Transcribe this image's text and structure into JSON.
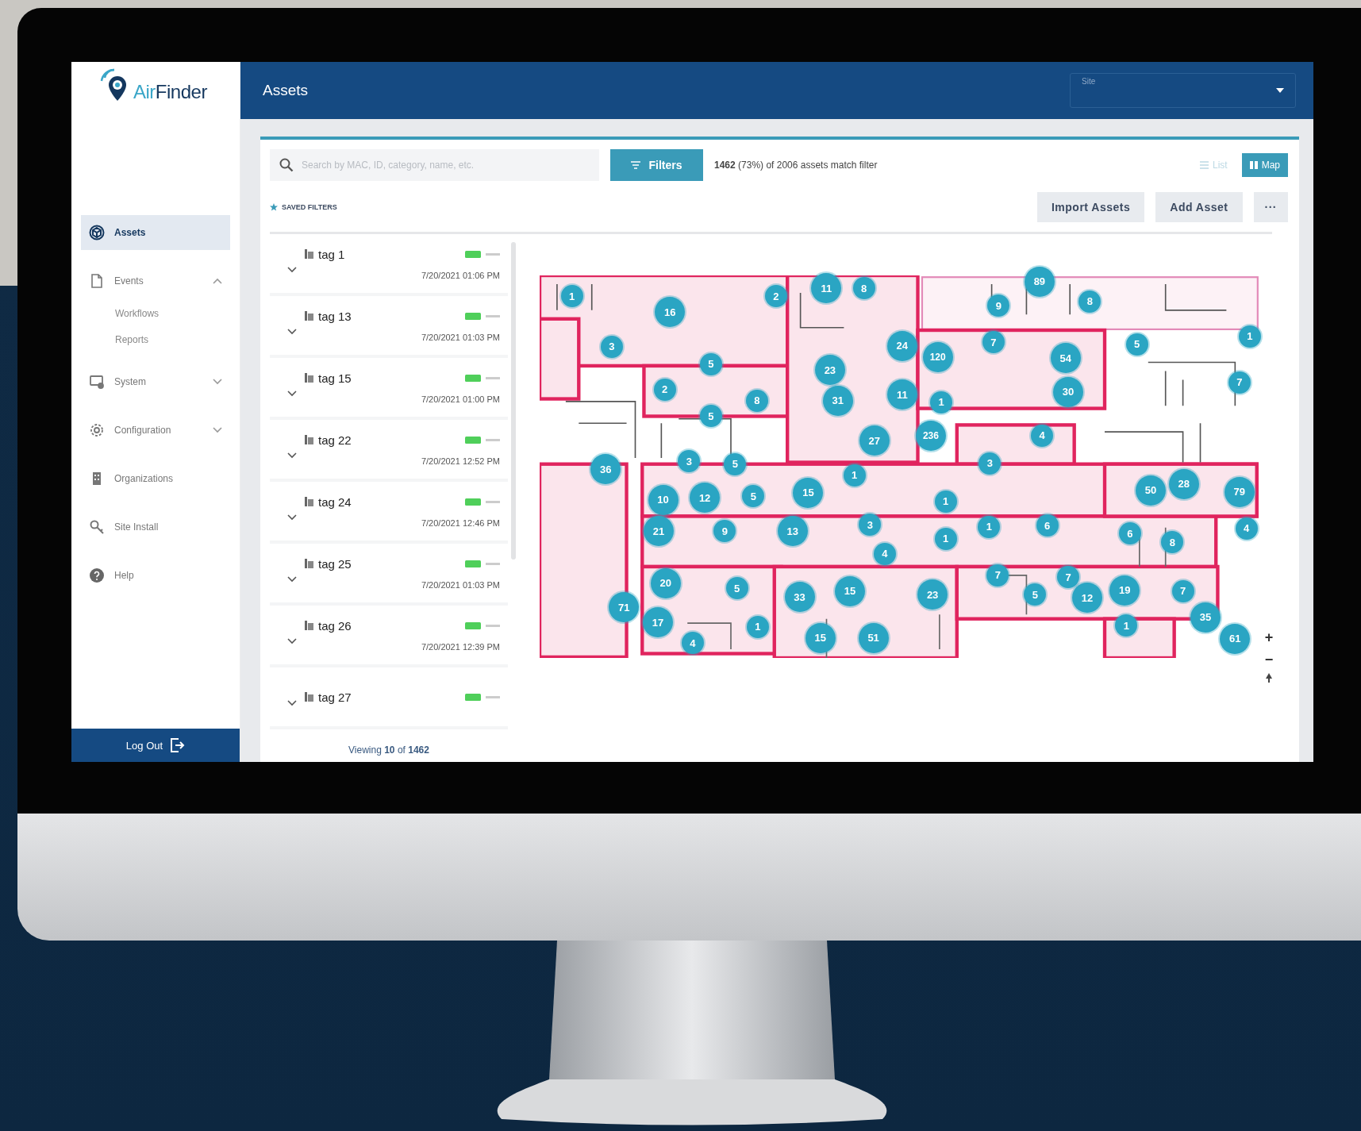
{
  "logo": {
    "lead": "Air",
    "rest": "Finder"
  },
  "header": {
    "title": "Assets",
    "site_label": "Site"
  },
  "nav": [
    {
      "label": "Assets",
      "selected": true
    },
    {
      "label": "Events",
      "selected": false,
      "expanded": true,
      "children": [
        {
          "label": "Workflows",
          "selected": false
        },
        {
          "label": "Reports",
          "selected": false
        }
      ]
    },
    {
      "label": "System",
      "selected": false,
      "expanded": false
    },
    {
      "label": "Configuration",
      "selected": false,
      "expanded": false
    },
    {
      "label": "Organizations",
      "selected": false
    },
    {
      "label": "Site Install",
      "selected": false
    },
    {
      "label": "Help",
      "selected": false
    }
  ],
  "logout": "Log Out",
  "search": {
    "placeholder": "Search by MAC, ID, category, name, etc."
  },
  "filters_button": "Filters",
  "match_summary": "**1462** (73%) of 2006 assets match filter",
  "view_toggle": [
    {
      "label": "List",
      "selected": false
    },
    {
      "label": "Map",
      "selected": true
    }
  ],
  "saved_filters": "SAVED FILTERS",
  "actions": [
    "Import Assets",
    "Add Asset",
    "···"
  ],
  "tags": [
    {
      "name": "tag 1",
      "time": "7/20/2021 01:06 PM"
    },
    {
      "name": "tag 13",
      "time": "7/20/2021 01:03 PM"
    },
    {
      "name": "tag 15",
      "time": "7/20/2021 01:00 PM"
    },
    {
      "name": "tag 22",
      "time": "7/20/2021 12:52 PM"
    },
    {
      "name": "tag 24",
      "time": "7/20/2021 12:46 PM"
    },
    {
      "name": "tag 25",
      "time": "7/20/2021 01:03 PM"
    },
    {
      "name": "tag 26",
      "time": "7/20/2021 12:39 PM"
    },
    {
      "name": "tag 27"
    }
  ],
  "footer": "Viewing **10** of **1462**",
  "map": {
    "zoom_in": "+",
    "zoom_out": "−",
    "markers": [
      "1",
      "16",
      "2",
      "11",
      "8",
      "89",
      "9",
      "8",
      "3",
      "5",
      "24",
      "120",
      "7",
      "54",
      "5",
      "1",
      "23",
      "2",
      "8",
      "31",
      "11",
      "30",
      "1",
      "7",
      "5",
      "236",
      "27",
      "4",
      "36",
      "3",
      "5",
      "3",
      "1",
      "10",
      "12",
      "5",
      "15",
      "1",
      "50",
      "28",
      "79",
      "21",
      "9",
      "13",
      "3",
      "4",
      "1",
      "1",
      "6",
      "6",
      "8",
      "4",
      "20",
      "5",
      "33",
      "15",
      "23",
      "7",
      "7",
      "5",
      "12",
      "19",
      "7",
      "71",
      "17",
      "1",
      "4",
      "15",
      "51",
      "1",
      "35",
      "61"
    ]
  }
}
